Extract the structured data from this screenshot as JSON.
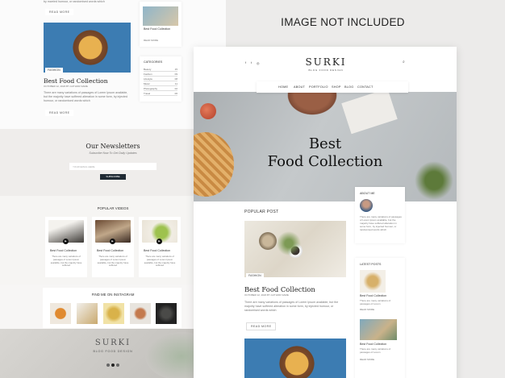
{
  "overlay": {
    "notice": "IMAGE NOT INCLUDED"
  },
  "left": {
    "top_byline": "by married humour, or randomised words which",
    "top_read_more": "READ MORE",
    "post_category": "FASHION",
    "post_title": "Best Food Collection",
    "post_meta": "OCTOBER 12, 2020 BY AUTHOR NAME",
    "post_excerpt": "There are many variations of passages of Lorem Ipsum available, but the majority have suffered alteration in some form, by injected humour, or randomised words which",
    "read_more": "READ MORE",
    "thumb_title": "Best Food Collection",
    "thumb_read_more": "READ MORE",
    "categories_title": "CATEGORIES",
    "categories": [
      {
        "name": "Beauty",
        "count": "15"
      },
      {
        "name": "Fashion",
        "count": "09"
      },
      {
        "name": "Lifestyle",
        "count": "08"
      },
      {
        "name": "Music",
        "count": "11"
      },
      {
        "name": "Photography",
        "count": "02"
      },
      {
        "name": "Travel",
        "count": "06"
      }
    ],
    "newsletter_title": "Our Newsletters",
    "newsletter_subtitle": "Subscribe Now To Get Daily Updates",
    "newsletter_placeholder": "YOUR EMAIL HERE",
    "subscribe_label": "SUBSCRIBE",
    "videos_title": "POPULAR VIDEOS",
    "videos": [
      {
        "title": "Best Food Collection",
        "text": "There are many variations of passages of Lorem Ipsum available, but the majority have suffered"
      },
      {
        "title": "Best Food Collection",
        "text": "There are many variations of passages of Lorem Ipsum available, but the majority have suffered"
      },
      {
        "title": "Best Food Collection",
        "text": "There are many variations of passages of Lorem Ipsum available, but the majority have suffered"
      }
    ],
    "instagram_title": "FIND ME ON INSTAGRAM",
    "footer_logo": "SURKI",
    "footer_tagline": "BLOG FOOD DESIGN"
  },
  "right": {
    "logo": "SURKI",
    "tagline": "BLOG FOOD DESIGN",
    "nav": [
      "HOME",
      "ABOUT",
      "PORTFOLIO",
      "SHOP",
      "BLOG",
      "CONTACT"
    ],
    "hero_title_line1": "Best",
    "hero_title_line2": "Food Collection",
    "popular_post_heading": "POPULAR POST",
    "post_category": "FASHION",
    "post_title": "Best Food Collection",
    "post_meta": "OCTOBER 12, 2020 BY AUTHOR NAME",
    "post_excerpt": "There are many variations of passages of Lorem Ipsum available, but the majority have suffered alteration in some form, by injected humour, or randomised words which",
    "read_more": "READ MORE",
    "about_title": "ABOUT ME",
    "about_text": "There are many variations of passages of Lorem Ipsum available, but the majority have suffered alteration in some form, by injected humour, or randomised words which",
    "latest_title": "LATEST POSTS",
    "latest_posts": [
      {
        "title": "Best Food Collection",
        "text": "There are many variations of passages of Lorem",
        "read_more": "READ MORE"
      },
      {
        "title": "Best Food Collection",
        "text": "There are many variations of passages of Lorem",
        "read_more": "READ MORE"
      }
    ]
  }
}
